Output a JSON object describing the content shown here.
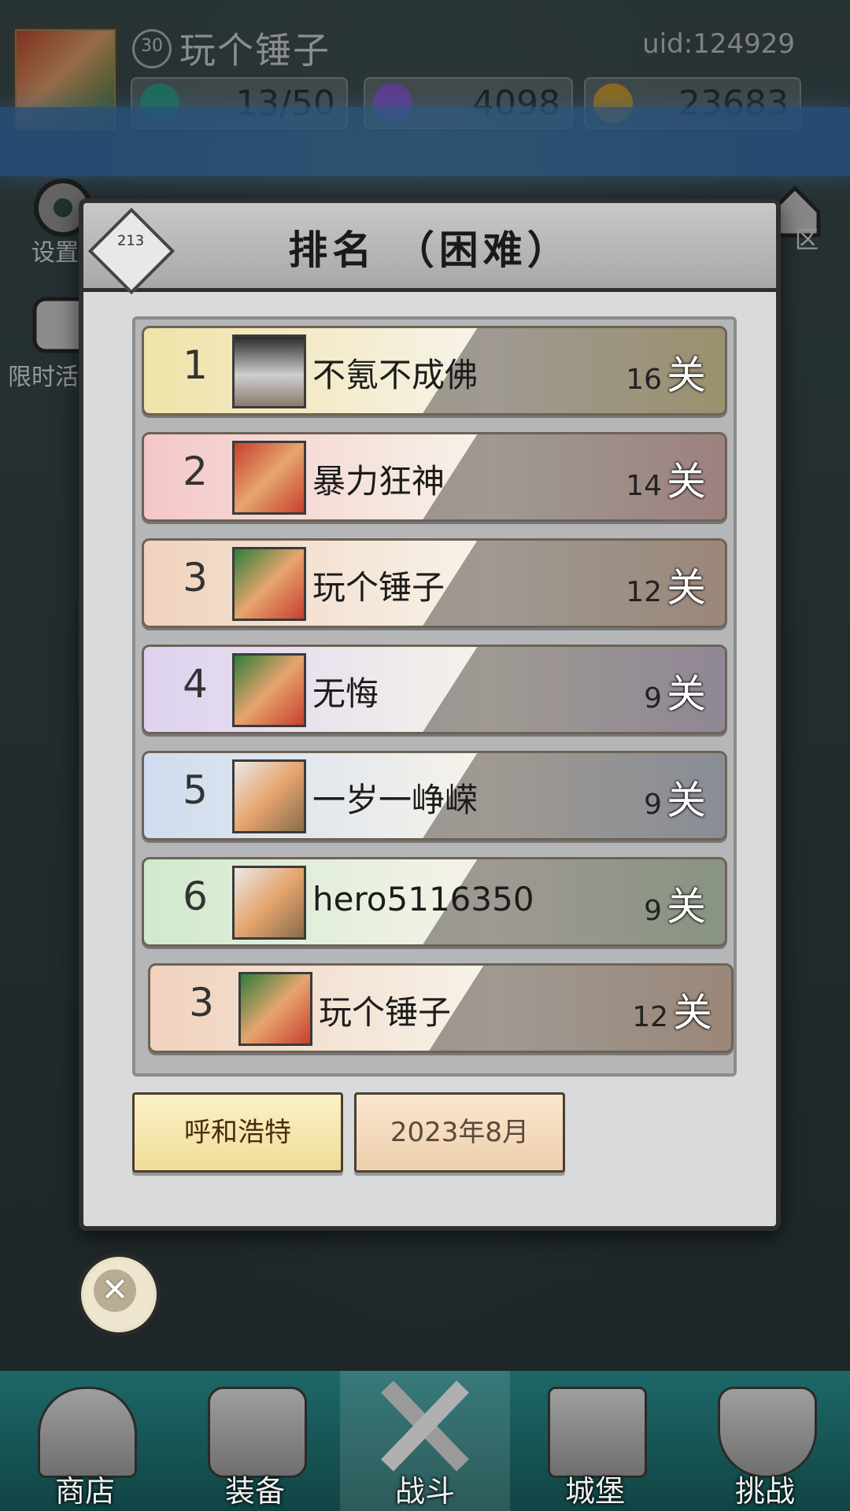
{
  "header": {
    "level": "30",
    "player_name": "玩个锤子",
    "uid": "uid:124929",
    "currencies": [
      {
        "icon": "green-gem-icon",
        "value": "13/50",
        "color": "#2ea487"
      },
      {
        "icon": "purple-crystal-icon",
        "value": "4098",
        "color": "#8f5bd6"
      },
      {
        "icon": "gold-coin-icon",
        "value": "23683",
        "color": "#d9a32f"
      }
    ]
  },
  "side": {
    "settings_label": "设置",
    "limited_label": "限时活",
    "zone_label": "区"
  },
  "modal": {
    "title": "排名 （困难）",
    "rank_icon_text": "213",
    "rows": [
      {
        "rank": "1",
        "name": "不氪不成佛",
        "score": "16",
        "unit": "关",
        "color": "#efe3a8",
        "avatar": "witch-avatar"
      },
      {
        "rank": "2",
        "name": "暴力狂神",
        "score": "14",
        "unit": "关",
        "color": "#f4c7c7",
        "avatar": "horned-girl-2024-avatar"
      },
      {
        "rank": "3",
        "name": "玩个锤子",
        "score": "12",
        "unit": "关",
        "color": "#f0d2bd",
        "avatar": "horned-girl-holiday-avatar"
      },
      {
        "rank": "4",
        "name": "无悔",
        "score": "9",
        "unit": "关",
        "color": "#ddd1f0",
        "avatar": "horned-girl-holiday-avatar"
      },
      {
        "rank": "5",
        "name": "一岁一峥嵘",
        "score": "9",
        "unit": "关",
        "color": "#cfdcef",
        "avatar": "horned-girl-avatar"
      },
      {
        "rank": "6",
        "name": "hero5116350",
        "score": "9",
        "unit": "关",
        "color": "#cfe9cd",
        "avatar": "horned-girl-avatar"
      }
    ],
    "self_row": {
      "rank": "3",
      "name": "玩个锤子",
      "score": "12",
      "unit": "关",
      "color": "#f0d2bd",
      "avatar": "horned-girl-holiday-avatar"
    },
    "region_button": "呼和浩特",
    "date_button": "2023年8月",
    "close_icon": "close-x-icon"
  },
  "nav": {
    "items": [
      {
        "label": "商店",
        "icon": "shop-hut-icon"
      },
      {
        "label": "装备",
        "icon": "backpack-icon"
      },
      {
        "label": "战斗",
        "icon": "crossed-swords-icon"
      },
      {
        "label": "城堡",
        "icon": "castle-tower-icon"
      },
      {
        "label": "挑战",
        "icon": "shield-crest-icon"
      }
    ]
  }
}
